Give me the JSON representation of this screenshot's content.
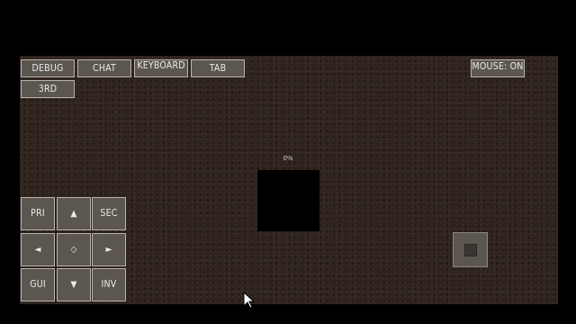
{
  "toolbar": {
    "debug_label": "DEBUG",
    "chat_label": "CHAT",
    "keyboard_label": "KEYBOARD",
    "tab_label": "TAB",
    "mouse_label": "MOUSE: ON",
    "third_person_label": "3RD"
  },
  "hud": {
    "crosshair_text": "0%"
  },
  "dpad": {
    "primary_label": "PRI",
    "up_glyph": "▲",
    "secondary_label": "SEC",
    "left_glyph": "◄",
    "center_glyph": "◇",
    "right_glyph": "►",
    "gui_label": "GUI",
    "down_glyph": "▼",
    "inventory_label": "INV"
  },
  "colors": {
    "ground": "#2c211a",
    "button_fill": "#5c5650",
    "button_border": "#b9b4ae",
    "button_text": "#ecebe8"
  },
  "icons": {
    "right_stick": "joystick-square-icon",
    "cursor": "mouse-pointer-icon"
  }
}
